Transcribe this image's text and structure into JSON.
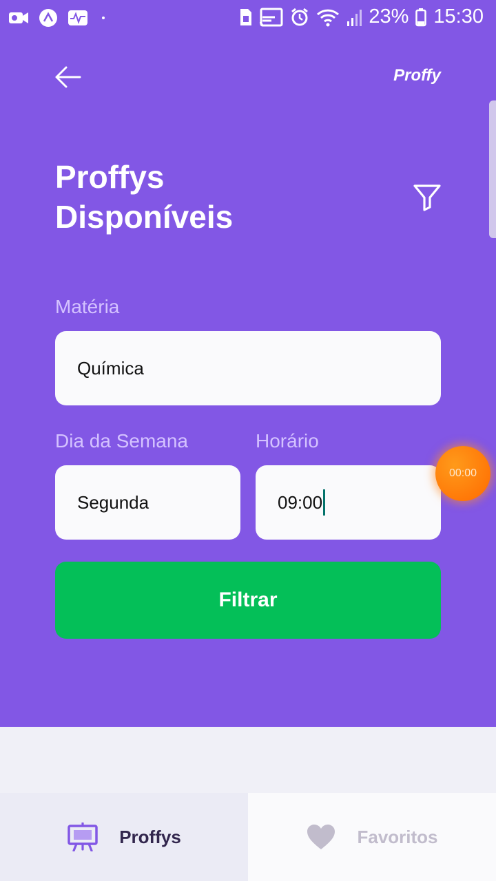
{
  "status_bar": {
    "battery": "23%",
    "time": "15:30"
  },
  "header": {
    "brand": "Proffy"
  },
  "page": {
    "title_line1": "Proffys",
    "title_line2": "Disponíveis"
  },
  "form": {
    "subject_label": "Matéria",
    "subject_value": "Química",
    "weekday_label": "Dia da Semana",
    "weekday_value": "Segunda",
    "time_label": "Horário",
    "time_value": "09:00",
    "submit_label": "Filtrar"
  },
  "timer_overlay": "00:00",
  "tabs": [
    {
      "label": "Proffys",
      "icon": "easel-icon",
      "active": true
    },
    {
      "label": "Favoritos",
      "icon": "heart-icon",
      "active": false
    }
  ],
  "colors": {
    "primary": "#8257e5",
    "secondary": "#04bf58",
    "background": "#f0f0f7",
    "timer": "#ff7a00"
  }
}
